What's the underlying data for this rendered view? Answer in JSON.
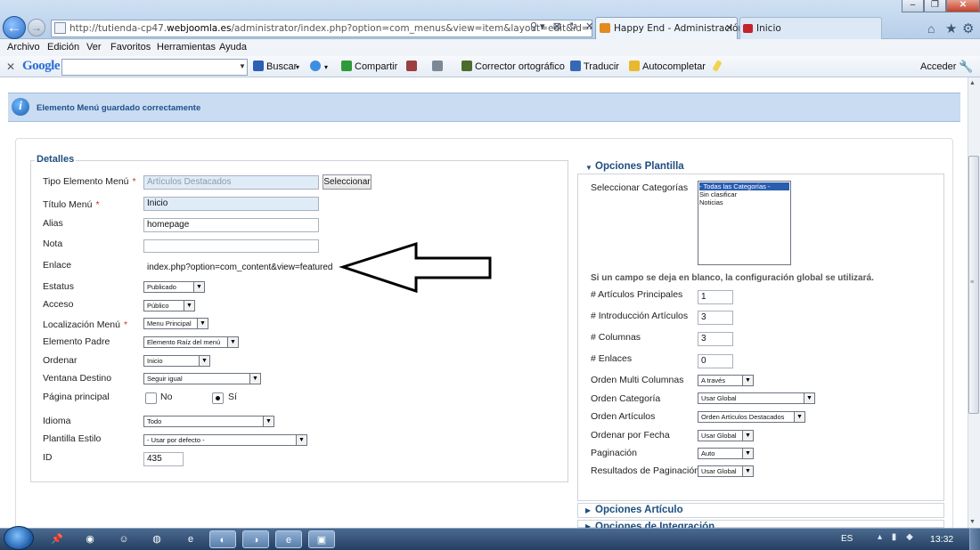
{
  "browser": {
    "url_prefix": "http://tutienda-cp47.",
    "url_domain": "webjoomla.es",
    "url_suffix": "/administrator/index.php?option=com_menus&view=item&layout=edit&id=435",
    "tab_active": "Happy End - Administración",
    "tab_other": "Inicio",
    "menu": [
      "Archivo",
      "Edición",
      "Ver",
      "Favoritos",
      "Herramientas",
      "Ayuda"
    ],
    "toolbar": {
      "google": "Google",
      "buscar": "Buscar",
      "compartir": "Compartir",
      "corrector": "Corrector ortográfico",
      "traducir": "Traducir",
      "autocompletar": "Autocompletar",
      "acceder": "Acceder"
    }
  },
  "message": "Elemento Menú guardado correctamente",
  "details": {
    "legend": "Detalles",
    "tipo_label": "Tipo Elemento Menú",
    "tipo_value": "Artículos Destacados",
    "seleccionar": "Seleccionar",
    "titulo_label": "Título Menú",
    "titulo_value": "Inicio",
    "alias_label": "Alias",
    "alias_value": "homepage",
    "nota_label": "Nota",
    "nota_value": "",
    "enlace_label": "Enlace",
    "enlace_value": "index.php?option=com_content&view=featured",
    "estatus_label": "Estatus",
    "estatus_value": "Publicado",
    "acceso_label": "Acceso",
    "acceso_value": "Público",
    "localizacion_label": "Localización Menú",
    "localizacion_value": "Menu Principal",
    "padre_label": "Elemento Padre",
    "padre_value": "Elemento Raíz del menú",
    "ordenar_label": "Ordenar",
    "ordenar_value": "Inicio",
    "ventana_label": "Ventana Destino",
    "ventana_value": "Seguir igual",
    "pagina_label": "Página principal",
    "pagina_no": "No",
    "pagina_si": "Sí",
    "pagina_selected": "Sí",
    "idioma_label": "Idioma",
    "idioma_value": "Todo",
    "plantilla_label": "Plantilla Estilo",
    "plantilla_value": "- Usar por defecto -",
    "id_label": "ID",
    "id_value": "435"
  },
  "plantilla": {
    "header": "Opciones Plantilla",
    "cats_label": "Seleccionar Categorías",
    "cats_options": [
      "- Todas las Categorías -",
      "Sin clasificar",
      "Noticias"
    ],
    "cats_selected": "- Todas las Categorías -",
    "note": "Si un campo se deja en blanco, la configuración global se utilizará.",
    "art_principales_label": "# Artículos Principales",
    "art_principales_value": "1",
    "intro_label": "# Introducción Artículos",
    "intro_value": "3",
    "columnas_label": "# Columnas",
    "columnas_value": "3",
    "enlaces_label": "# Enlaces",
    "enlaces_value": "0",
    "multi_label": "Orden Multi Columnas",
    "multi_value": "A través",
    "orden_cat_label": "Orden Categoría",
    "orden_cat_value": "Usar Global",
    "orden_art_label": "Orden Artículos",
    "orden_art_value": "Orden Artículos Destacados",
    "orden_fecha_label": "Ordenar por Fecha",
    "orden_fecha_value": "Usar Global",
    "paginacion_label": "Paginación",
    "paginacion_value": "Auto",
    "resultados_label": "Resultados de Paginación",
    "resultados_value": "Usar Global"
  },
  "sections": [
    "Opciones Artículo",
    "Opciones de Integración"
  ],
  "taskbar": {
    "lang": "ES",
    "clock": "13:32"
  }
}
